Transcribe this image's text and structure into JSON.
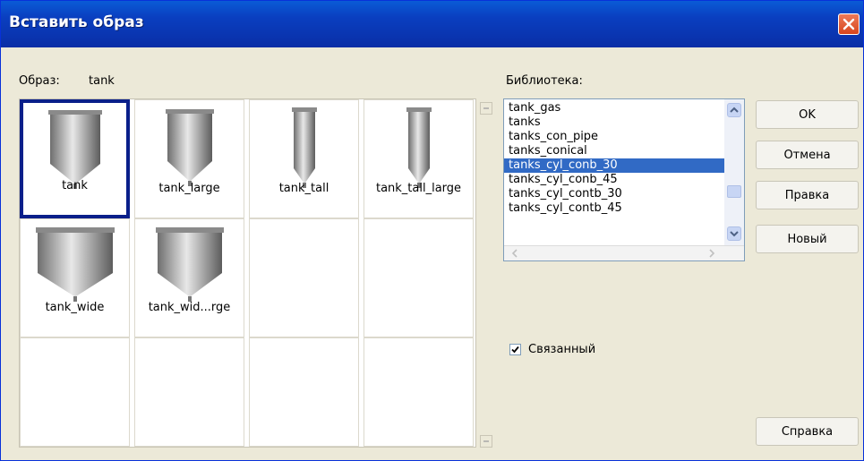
{
  "window": {
    "title": "Вставить образ"
  },
  "image_label": "Образ:",
  "image_value": "tank",
  "thumbnails": [
    {
      "caption": "tank",
      "selected": true
    },
    {
      "caption": "tank_large",
      "selected": false
    },
    {
      "caption": "tank_tall",
      "selected": false
    },
    {
      "caption": "tank_tall_large",
      "selected": false
    },
    {
      "caption": "tank_wide",
      "selected": false
    },
    {
      "caption": "tank_wid...rge",
      "selected": false
    }
  ],
  "library": {
    "label": "Библиотека:",
    "items": [
      "tank_gas",
      "tanks",
      "tanks_con_pipe",
      "tanks_conical",
      "tanks_cyl_conb_30",
      "tanks_cyl_conb_45",
      "tanks_cyl_contb_30",
      "tanks_cyl_contb_45"
    ],
    "selected": "tanks_cyl_conb_30"
  },
  "buttons": {
    "ok": "OK",
    "cancel": "Отмена",
    "edit": "Правка",
    "new": "Новый",
    "help": "Справка"
  },
  "linked": {
    "label": "Связанный",
    "checked": true
  }
}
